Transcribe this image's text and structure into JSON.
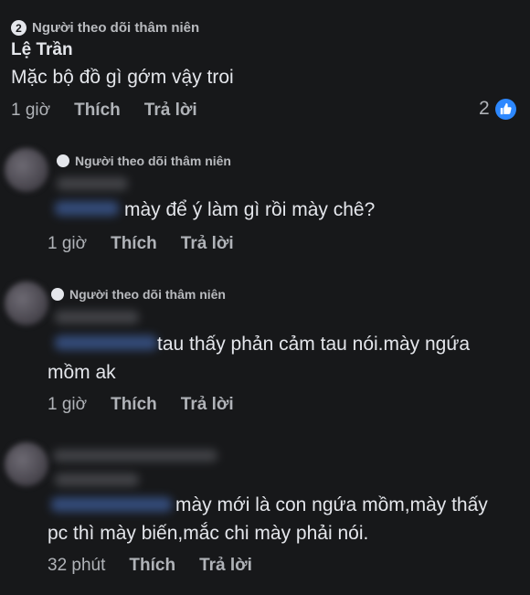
{
  "comments": [
    {
      "badge": "Người theo dõi thâm niên",
      "badge_number": "2",
      "author": "Lệ Trần",
      "text": "Mặc bộ đồ gì gớm vậy troi",
      "time": "1 giờ",
      "like_label": "Thích",
      "reply_label": "Trả lời",
      "reactions": "2"
    },
    {
      "badge": "Người theo dõi thâm niên",
      "text": "mày để ý làm gì rồi mày chê?",
      "time": "1 giờ",
      "like_label": "Thích",
      "reply_label": "Trả lời"
    },
    {
      "badge": "Người theo dõi thâm niên",
      "text_line1": "tau thấy phản cảm tau nói.mày ngứa",
      "text_line2": "mồm ak",
      "time": "1 giờ",
      "like_label": "Thích",
      "reply_label": "Trả lời"
    },
    {
      "text_line1": "mày mới là con ngứa mồm,mày thấy",
      "text_line2": "pc thì mày biến,mắc chi mày phải nói.",
      "time": "32 phút",
      "like_label": "Thích",
      "reply_label": "Trả lời"
    }
  ],
  "colors": {
    "background": "#17181a",
    "text": "#e4e6eb",
    "muted": "#b0b3b8",
    "like_blue": "#2d88ff"
  }
}
